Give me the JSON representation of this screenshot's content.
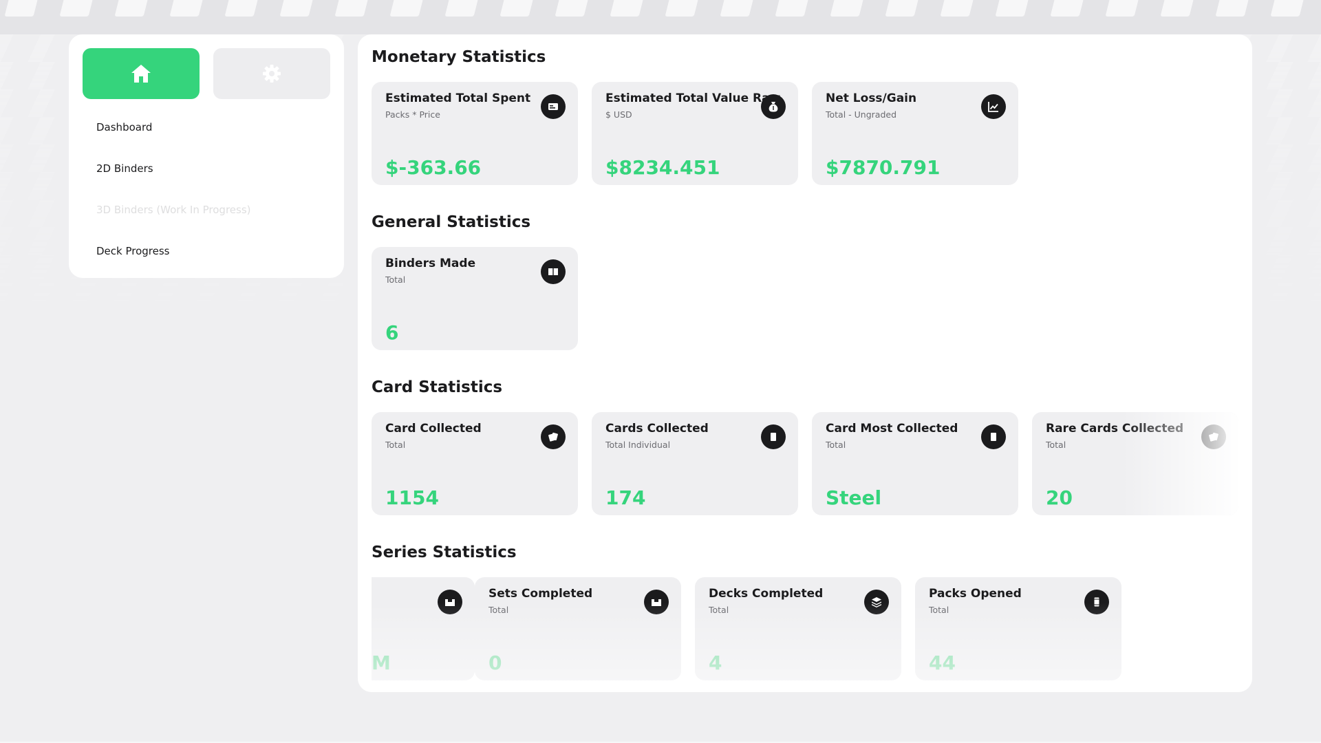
{
  "colors": {
    "accent": "#35d47c",
    "card_bg": "#efeff1",
    "icon_bg": "#1b1b1d",
    "text": "#1b1b1d",
    "muted": "#6b6b70"
  },
  "sidebar": {
    "home_icon": "home-icon",
    "settings_icon": "gear-icon",
    "items": [
      {
        "label": "Dashboard",
        "enabled": true
      },
      {
        "label": "2D Binders",
        "enabled": true
      },
      {
        "label": "3D Binders (Work In Progress)",
        "enabled": false
      },
      {
        "label": "Deck Progress",
        "enabled": true
      }
    ]
  },
  "sections": {
    "monetary": {
      "title": "Monetary Statistics",
      "cards": [
        {
          "title": "Estimated Total Spent",
          "subtitle": "Packs * Price",
          "value": "$-363.66",
          "icon": "price-tag-icon"
        },
        {
          "title": "Estimated Total Value Raw",
          "subtitle": "$ USD",
          "value": "$8234.451",
          "icon": "money-bag-icon"
        },
        {
          "title": "Net Loss/Gain",
          "subtitle": "Total - Ungraded",
          "value": "$7870.791",
          "icon": "chart-line-icon"
        }
      ]
    },
    "general": {
      "title": "General Statistics",
      "cards": [
        {
          "title": "Binders Made",
          "subtitle": "Total",
          "value": "6",
          "icon": "open-book-icon"
        }
      ]
    },
    "card": {
      "title": "Card Statistics",
      "cards": [
        {
          "title": "Card Collected",
          "subtitle": "Total",
          "value": "1154",
          "icon": "cards-icon"
        },
        {
          "title": "Cards Collected",
          "subtitle": "Total Individual",
          "value": "174",
          "icon": "single-card-icon"
        },
        {
          "title": "Card Most Collected",
          "subtitle": "Total",
          "value": "Steel",
          "icon": "single-card-icon"
        },
        {
          "title": "Rare Cards Collected",
          "subtitle": "Total",
          "value": "20",
          "icon": "cards-icon"
        }
      ]
    },
    "series": {
      "title": "Series Statistics",
      "partial_card": {
        "value": "M",
        "icon": "box-icon"
      },
      "cards": [
        {
          "title": "Sets Completed",
          "subtitle": "Total",
          "value": "0",
          "icon": "box-icon"
        },
        {
          "title": "Decks Completed",
          "subtitle": "Total",
          "value": "4",
          "icon": "layers-icon"
        },
        {
          "title": "Packs Opened",
          "subtitle": "Total",
          "value": "44",
          "icon": "pack-icon"
        }
      ]
    }
  }
}
